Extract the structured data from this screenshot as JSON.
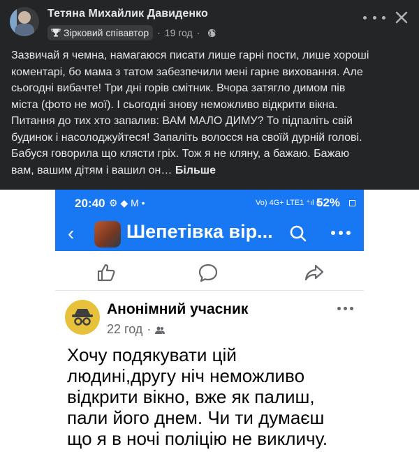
{
  "post": {
    "author": "Тетяна Михайлик Давиденко",
    "badge": "Зірковий співавтор",
    "time": "19 год",
    "separator": "·",
    "text_lines": [
      "Зазвичай я чемна, намагаюся писати лише гарні пости, лише хороші",
      "коментарі, бо мама з татом забезпечили мені гарне виховання. Але",
      "сьогодні вибачте! Три дні горів смітник. Вчора затягло димом пів",
      "міста (фото не мої). І сьогодні знову неможливо відкрити вікна.",
      "Питання до тих хто запалив: ВАМ МАЛО ДИМУ?  То підпаліть свій",
      "будинок і насолоджуйтеся! Запаліть волосся на своїй дурній голові.",
      "Бабуся говорила що клясти гріх. Тож я не кляну, а бажаю. Бажаю",
      "вам, вашим дітям і вашил он… "
    ],
    "see_more": "Більше",
    "icons": {
      "badge": "trophy-icon",
      "audience": "globe-icon",
      "more": "more-dots-icon",
      "close": "close-icon"
    }
  },
  "screenshot": {
    "status": {
      "time": "20:40",
      "left_icons": "⚙ ◆ M •",
      "right_icons": "Vo) 4G+ LTE1 ⁺ıl ıl",
      "battery": "52%"
    },
    "appbar": {
      "group_name": "Шепетівка вір...",
      "icons": {
        "back": "back-arrow-icon",
        "search": "search-icon",
        "menu": "more-dots-icon"
      }
    },
    "actions": {
      "like": "like-icon",
      "comment": "comment-icon",
      "share": "share-icon"
    },
    "comment": {
      "author": "Анонімний учасник",
      "time": "22 год",
      "separator": "·",
      "text_lines": [
        "Хочу подякувати цій",
        "людині,другу ніч неможливо",
        "відкрити вікно, вже як палиш,",
        "пали його днем. Чи ти думаєш",
        "що я в ночі  поліцію не викличу."
      ]
    }
  },
  "colors": {
    "dark_bg": "#242526",
    "fb_blue": "#1877f2",
    "anon_yellow": "#e7c13c"
  }
}
